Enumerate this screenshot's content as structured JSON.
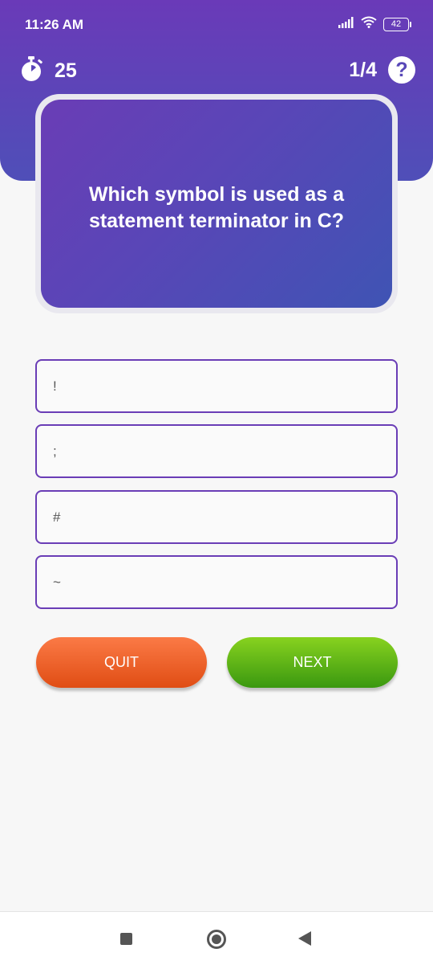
{
  "status_bar": {
    "time": "11:26 AM",
    "battery": "42",
    "icons": [
      "signal-icon",
      "wifi-icon",
      "battery-icon"
    ]
  },
  "quiz": {
    "timer_value": "25",
    "progress": "1/4",
    "help_symbol": "?",
    "question": "Which symbol is used as a statement terminator in C?",
    "options": [
      "!",
      ";",
      "#",
      "~"
    ]
  },
  "actions": {
    "quit_label": "QUIT",
    "next_label": "NEXT"
  },
  "colors": {
    "header": "#6a3ab8",
    "option_border": "#6a3db6",
    "quit": "#f0622a",
    "next": "#5cb516"
  }
}
